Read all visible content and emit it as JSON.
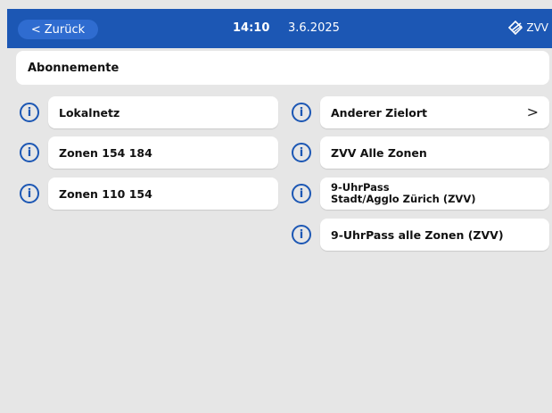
{
  "header": {
    "back_label": "Zurück",
    "back_icon": "chevron-left-icon",
    "time": "14:10",
    "date": "3.6.2025",
    "logo_text": "ZVV",
    "color": "#1c57b4"
  },
  "section_title": "Abonnemente",
  "left_items": [
    {
      "label": "Lokalnetz"
    },
    {
      "label": "Zonen 154 184"
    },
    {
      "label": "Zonen 110 154"
    }
  ],
  "right_items": [
    {
      "label": "Anderer Zielort",
      "has_chevron": true
    },
    {
      "label": "ZVV Alle Zonen"
    },
    {
      "label_line1": "9-UhrPass",
      "label_line2": "Stadt/Agglo Zürich (ZVV)"
    },
    {
      "label": "9-UhrPass alle Zonen (ZVV)"
    }
  ],
  "info_glyph": "i"
}
